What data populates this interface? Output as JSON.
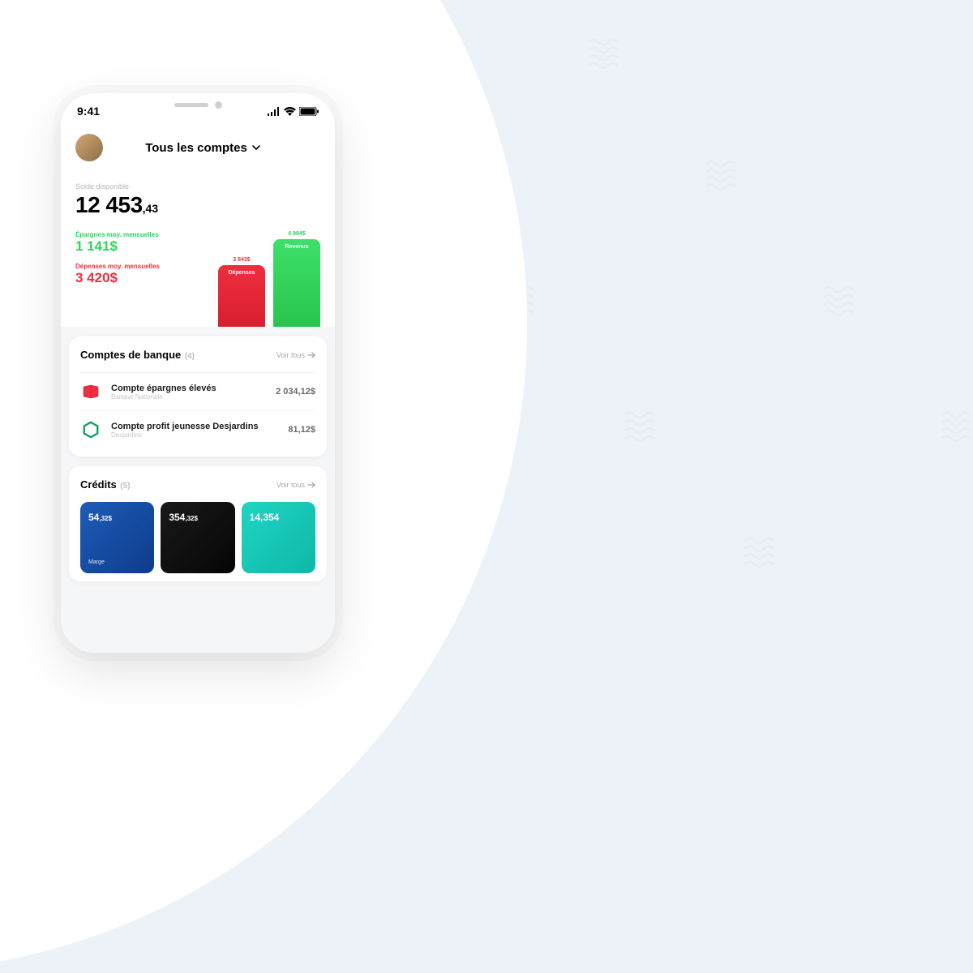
{
  "status_bar": {
    "time": "9:41"
  },
  "header": {
    "title": "Tous les comptes"
  },
  "balance": {
    "label": "Solde disponible",
    "main": "12 453",
    "cents": ",43"
  },
  "savings": {
    "label": "Épargnes moy. mensuelles",
    "value": "1 141$"
  },
  "expenses": {
    "label": "Dépenses moy. mensuelles",
    "value": "3 420$"
  },
  "bar_expense": {
    "top": "3 843$",
    "label": "Dépenses"
  },
  "bar_income": {
    "top": "4 984$",
    "label": "Revenus"
  },
  "accounts_section": {
    "title": "Comptes de banque",
    "count": "(4)",
    "see_all": "Voir tous",
    "items": [
      {
        "name": "Compte épargnes élevés",
        "bank": "Banque Nationale",
        "amount": "2 034,12$"
      },
      {
        "name": "Compte profit jeunesse Desjardins",
        "bank": "Desjardins",
        "amount": "81,12$"
      }
    ]
  },
  "credits_section": {
    "title": "Crédits",
    "count": "(5)",
    "see_all": "Voir tous",
    "cards": [
      {
        "amount": "54",
        "cents": ",32$",
        "label": "Marge"
      },
      {
        "amount": "354",
        "cents": ",32$",
        "label": ""
      },
      {
        "amount": "14,354",
        "cents": "",
        "label": ""
      }
    ]
  },
  "chart_data": {
    "type": "bar",
    "categories": [
      "Dépenses",
      "Revenus"
    ],
    "values": [
      3843,
      4984
    ],
    "title": "",
    "xlabel": "",
    "ylabel": "$",
    "ylim": [
      0,
      5000
    ]
  }
}
